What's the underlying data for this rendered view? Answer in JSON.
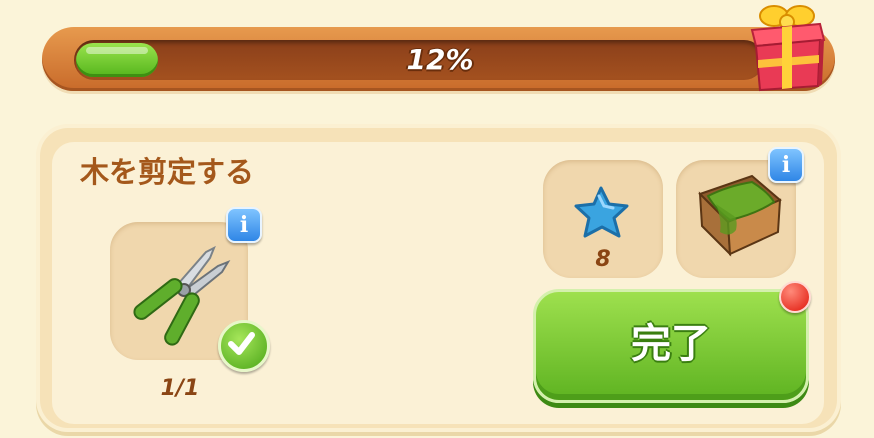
{
  "progress": {
    "percent_label": "12%",
    "fraction": 0.12,
    "fill_color": "#5bc01f"
  },
  "gift": {
    "icon": "gift-box-icon"
  },
  "task": {
    "title": "木を剪定する",
    "tool": {
      "icon": "pruning-shears-icon",
      "count": "1/1",
      "status_icon": "checkmark-icon"
    },
    "rewards": [
      {
        "icon": "blue-star-icon",
        "amount": "8"
      },
      {
        "icon": "grass-crate-icon",
        "amount": ""
      }
    ],
    "complete_button": {
      "label": "完了",
      "color": "#6cbf2a"
    }
  }
}
